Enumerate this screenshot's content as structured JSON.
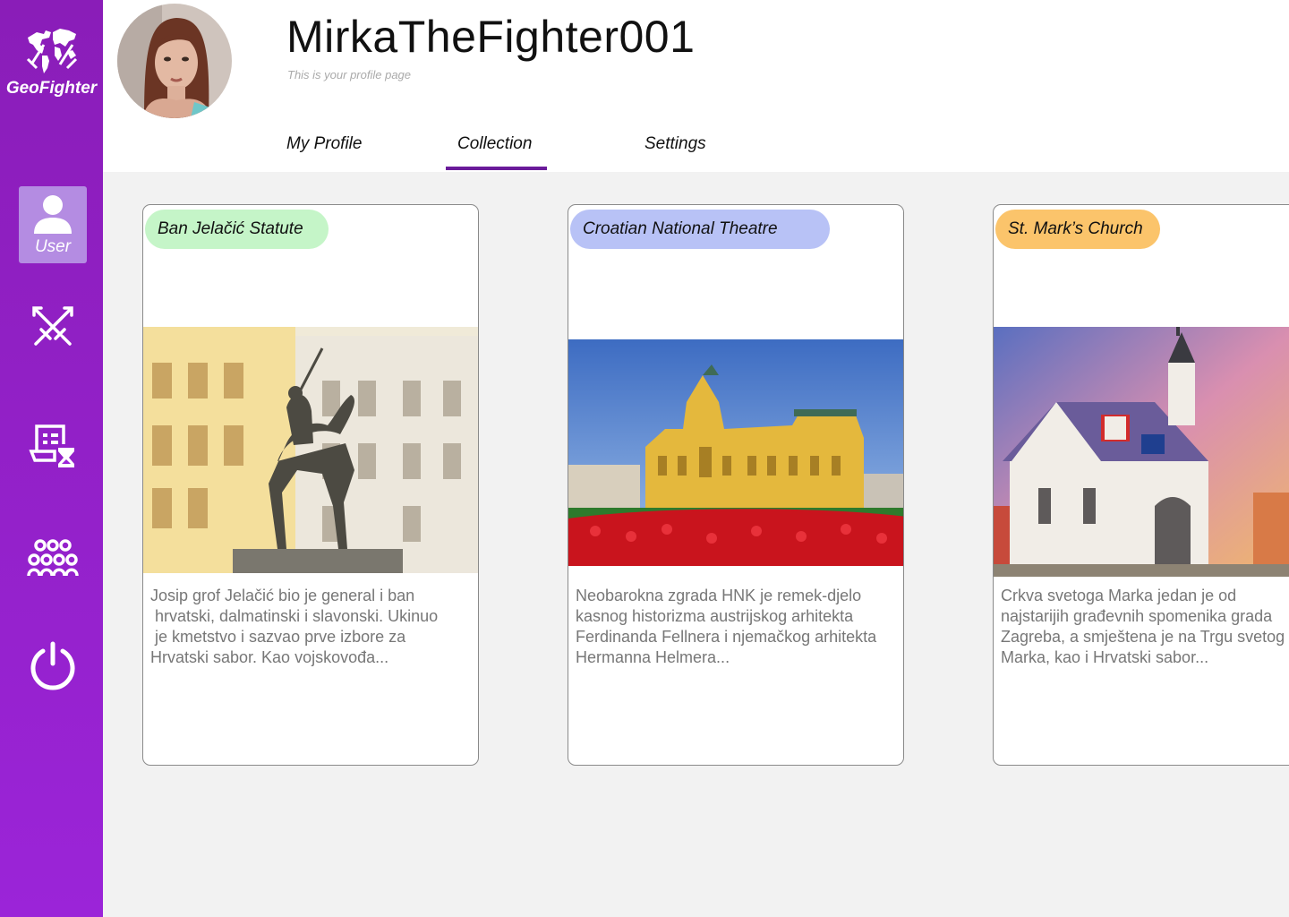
{
  "app": {
    "name": "GeoFighter"
  },
  "colors": {
    "sidebar": "#8a1db8",
    "accent": "#6a1b9a",
    "background": "#f2f2f2"
  },
  "sidebar": {
    "items": [
      {
        "label": "User",
        "icon": "user-icon",
        "active": true
      },
      {
        "label": "",
        "icon": "crossed-swords-icon",
        "active": false
      },
      {
        "label": "",
        "icon": "quest-hourglass-icon",
        "active": false
      },
      {
        "label": "",
        "icon": "group-icon",
        "active": false
      },
      {
        "label": "",
        "icon": "power-icon",
        "active": false
      }
    ]
  },
  "profile": {
    "username": "MirkaTheFighter001",
    "subtitle": "This is your profile page"
  },
  "tabs": [
    {
      "label": "My Profile",
      "active": false
    },
    {
      "label": "Collection",
      "active": true
    },
    {
      "label": "Settings",
      "active": false
    }
  ],
  "cards": [
    {
      "title": "Ban Jelačić Statute",
      "color": "#c5f5c8",
      "description": "Josip grof Jelačić bio je general i ban\n hrvatski, dalmatinski i slavonski. Ukinuo\n je kmetstvo i sazvao prve izbore za\nHrvatski sabor. Kao vojskovođa..."
    },
    {
      "title": "Croatian National Theatre",
      "color": "#b8c2f6",
      "description": "Neobarokna zgrada HNK je remek-djelo\nkasnog historizma austrijskog arhitekta\nFerdinanda Fellnera i njemačkog arhitekta\nHermanna Helmera..."
    },
    {
      "title": "St. Mark’s Church",
      "color": "#fbc46b",
      "description": "Crkva svetoga Marka jedan je od\nnajstarijih građevnih spomenika grada\nZagreba, a smještena je na Trgu svetog\nMarka, kao i Hrvatski sabor..."
    }
  ]
}
